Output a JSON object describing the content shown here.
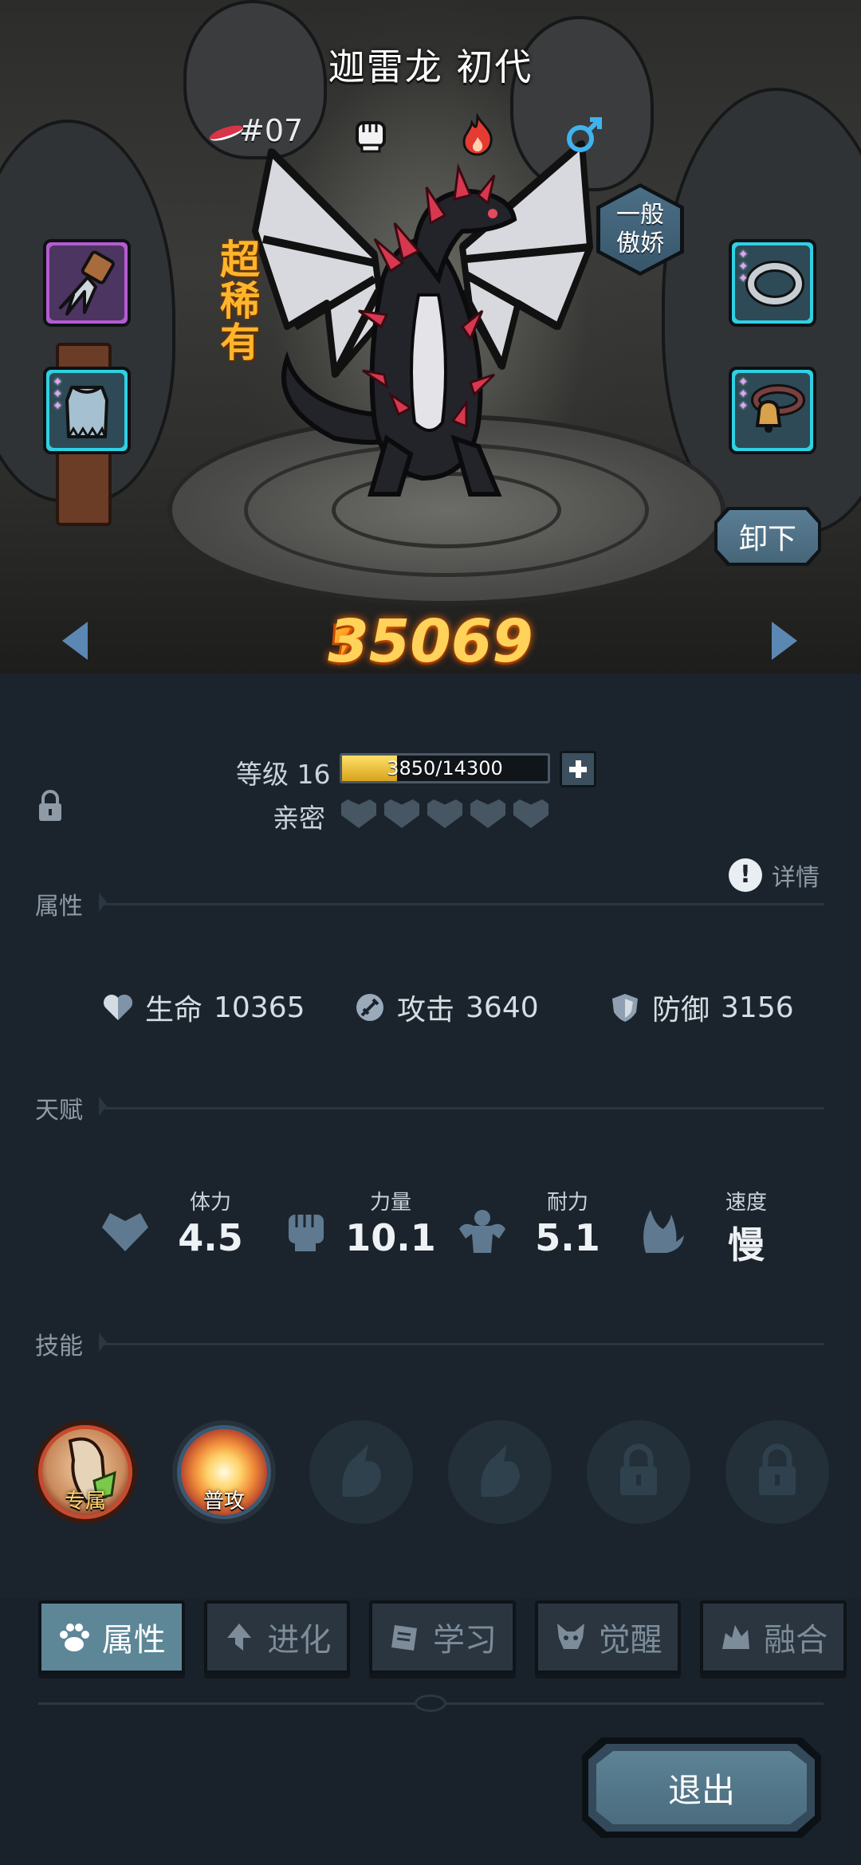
{
  "pet": {
    "name": "迦雷龙 初代",
    "number": "#07",
    "rarity": "超稀有",
    "personality": [
      "一般",
      "傲娇"
    ],
    "power": "35069",
    "colors": {
      "power": "#ffd25a",
      "rarity": "#ffb52a",
      "accent_blue": "#5b88b3"
    }
  },
  "top_icons": [
    "fist-element-icon",
    "fire-element-icon",
    "male-gender-icon"
  ],
  "equipment": {
    "left": [
      {
        "icon": "claw-gauntlet-icon",
        "stars": 0,
        "frame": "purple"
      },
      {
        "icon": "armor-vest-icon",
        "stars": 3,
        "frame": "cyan"
      }
    ],
    "right": [
      {
        "icon": "bracelet-icon",
        "stars": 3,
        "frame": "cyan"
      },
      {
        "icon": "bell-collar-icon",
        "stars": 3,
        "frame": "cyan"
      }
    ]
  },
  "unequip_label": "卸下",
  "level": {
    "label": "等级 16",
    "xp_text": "3850/14300",
    "xp_fraction": 0.269
  },
  "intimacy": {
    "label": "亲密",
    "hearts": 5
  },
  "sections": {
    "attributes": "属性",
    "talent": "天赋",
    "skills": "技能"
  },
  "detail_label": "详情",
  "stats": [
    {
      "name": "生命",
      "value": "10365",
      "icon": "hp-heart-icon"
    },
    {
      "name": "攻击",
      "value": "3640",
      "icon": "attack-sword-icon"
    },
    {
      "name": "防御",
      "value": "3156",
      "icon": "defense-shield-icon"
    }
  ],
  "talents": [
    {
      "name": "体力",
      "value": "4.5",
      "icon": "stamina-heart-icon"
    },
    {
      "name": "力量",
      "value": "10.1",
      "icon": "strength-fist-icon"
    },
    {
      "name": "耐力",
      "value": "5.1",
      "icon": "endurance-muscle-icon"
    },
    {
      "name": "速度",
      "value": "慢",
      "icon": "speed-wing-icon"
    }
  ],
  "skills": [
    {
      "label": "专属",
      "state": "exclusive"
    },
    {
      "label": "普攻",
      "state": "normal"
    },
    {
      "label": "",
      "state": "empty"
    },
    {
      "label": "",
      "state": "empty"
    },
    {
      "label": "",
      "state": "locked"
    },
    {
      "label": "",
      "state": "locked"
    }
  ],
  "tabs": [
    {
      "label": "属性",
      "icon": "paw-icon",
      "active": true
    },
    {
      "label": "进化",
      "icon": "evolve-arrow-icon",
      "active": false
    },
    {
      "label": "学习",
      "icon": "book-icon",
      "active": false
    },
    {
      "label": "觉醒",
      "icon": "beast-head-icon",
      "active": false
    },
    {
      "label": "融合",
      "icon": "fusion-icon",
      "active": false
    }
  ],
  "exit_label": "退出"
}
